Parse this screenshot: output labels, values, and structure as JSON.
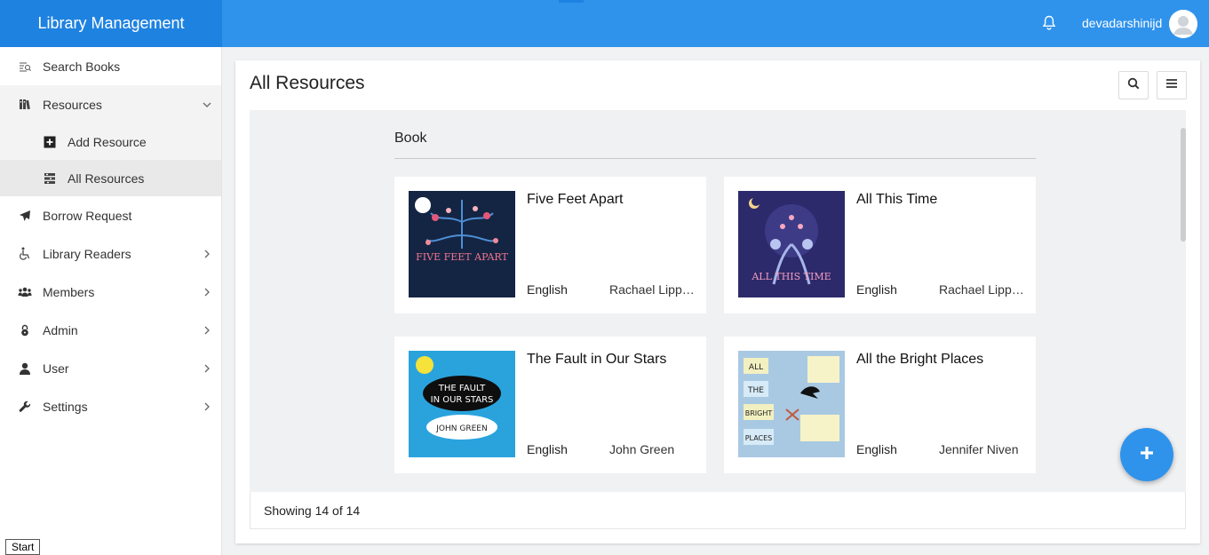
{
  "app": {
    "title": "Library Management"
  },
  "header": {
    "username": "devadarshinijd"
  },
  "sidebar": {
    "items": [
      {
        "label": "Search Books",
        "icon": "search-list-icon"
      },
      {
        "label": "Resources",
        "icon": "books-icon",
        "expanded": true,
        "children": [
          {
            "label": "Add Resource",
            "icon": "plus-square-icon"
          },
          {
            "label": "All Resources",
            "icon": "list-icon",
            "active": true
          }
        ]
      },
      {
        "label": "Borrow Request",
        "icon": "paper-plane-icon"
      },
      {
        "label": "Library Readers",
        "icon": "wheelchair-icon"
      },
      {
        "label": "Members",
        "icon": "users-icon"
      },
      {
        "label": "Admin",
        "icon": "lock-icon"
      },
      {
        "label": "User",
        "icon": "user-icon"
      },
      {
        "label": "Settings",
        "icon": "wrench-icon"
      }
    ]
  },
  "main": {
    "title": "All Resources",
    "section": "Book",
    "books": [
      {
        "title": "Five Feet Apart",
        "language": "English",
        "author": "Rachael Lippincott"
      },
      {
        "title": "All This Time",
        "language": "English",
        "author": "Rachael Lippincott"
      },
      {
        "title": "The Fault in Our Stars",
        "language": "English",
        "author": "John Green"
      },
      {
        "title": "All the Bright Places",
        "language": "English",
        "author": "Jennifer Niven"
      }
    ],
    "covers": {
      "c1": "FIVE FEET APART",
      "c2": "ALL THIS TIME",
      "c3a": "THE FAULT",
      "c3b": "IN OUR STARS",
      "c3c": "JOHN GREEN",
      "c4a": "ALL",
      "c4b": "THE",
      "c4c": "BRIGHT",
      "c4d": "PLACES"
    },
    "footer": "Showing 14 of 14"
  },
  "taskbar": {
    "tooltip": "Start"
  },
  "colors": {
    "primary": "#2f93ec",
    "brand": "#1e82e0"
  }
}
